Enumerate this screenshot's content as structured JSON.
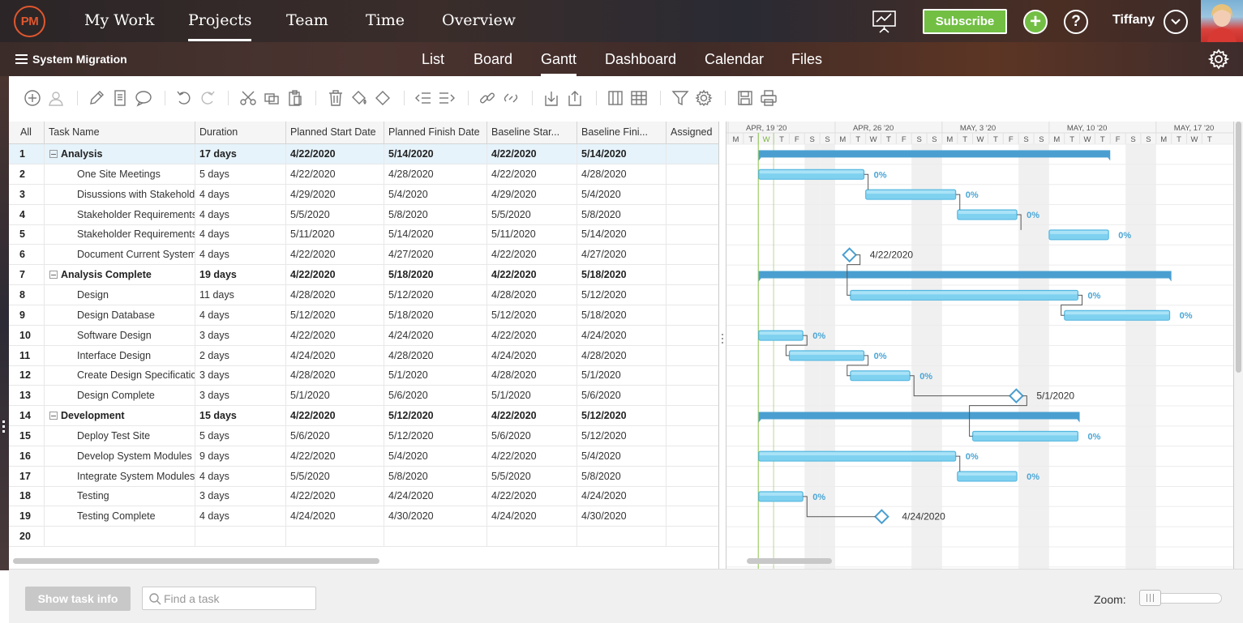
{
  "topnav": {
    "logo": "PM",
    "items": [
      "My Work",
      "Projects",
      "Team",
      "Time",
      "Overview"
    ],
    "active": "Projects",
    "subscribe": "Subscribe",
    "user": "Tiffany"
  },
  "subnav": {
    "project": "System Migration",
    "items": [
      "List",
      "Board",
      "Gantt",
      "Dashboard",
      "Calendar",
      "Files"
    ],
    "active": "Gantt"
  },
  "grid": {
    "columns": [
      "All",
      "Task Name",
      "Duration",
      "Planned Start Date",
      "Planned Finish Date",
      "Baseline Star...",
      "Baseline Fini...",
      "Assigned"
    ],
    "rows": [
      {
        "id": "1",
        "name": "Analysis",
        "duration": "17 days",
        "start": "4/22/2020",
        "finish": "5/14/2020",
        "bstart": "4/22/2020",
        "bfinish": "5/14/2020",
        "group": true,
        "selected": true
      },
      {
        "id": "2",
        "name": "One Site Meetings",
        "duration": "5 days",
        "start": "4/22/2020",
        "finish": "4/28/2020",
        "bstart": "4/22/2020",
        "bfinish": "4/28/2020"
      },
      {
        "id": "3",
        "name": "Disussions with Stakehold",
        "duration": "4 days",
        "start": "4/29/2020",
        "finish": "5/4/2020",
        "bstart": "4/29/2020",
        "bfinish": "5/4/2020"
      },
      {
        "id": "4",
        "name": "Stakeholder Requirements",
        "duration": "4 days",
        "start": "5/5/2020",
        "finish": "5/8/2020",
        "bstart": "5/5/2020",
        "bfinish": "5/8/2020"
      },
      {
        "id": "5",
        "name": "Stakeholder Requirements",
        "duration": "4 days",
        "start": "5/11/2020",
        "finish": "5/14/2020",
        "bstart": "5/11/2020",
        "bfinish": "5/14/2020"
      },
      {
        "id": "6",
        "name": "Document Current System",
        "duration": "4 days",
        "start": "4/22/2020",
        "finish": "4/27/2020",
        "bstart": "4/22/2020",
        "bfinish": "4/27/2020"
      },
      {
        "id": "7",
        "name": "Analysis Complete",
        "duration": "19 days",
        "start": "4/22/2020",
        "finish": "5/18/2020",
        "bstart": "4/22/2020",
        "bfinish": "5/18/2020",
        "group": true
      },
      {
        "id": "8",
        "name": "Design",
        "duration": "11 days",
        "start": "4/28/2020",
        "finish": "5/12/2020",
        "bstart": "4/28/2020",
        "bfinish": "5/12/2020"
      },
      {
        "id": "9",
        "name": "Design Database",
        "duration": "4 days",
        "start": "5/12/2020",
        "finish": "5/18/2020",
        "bstart": "5/12/2020",
        "bfinish": "5/18/2020"
      },
      {
        "id": "10",
        "name": "Software Design",
        "duration": "3 days",
        "start": "4/22/2020",
        "finish": "4/24/2020",
        "bstart": "4/22/2020",
        "bfinish": "4/24/2020"
      },
      {
        "id": "11",
        "name": "Interface Design",
        "duration": "2 days",
        "start": "4/24/2020",
        "finish": "4/28/2020",
        "bstart": "4/24/2020",
        "bfinish": "4/28/2020"
      },
      {
        "id": "12",
        "name": "Create Design Specificatic",
        "duration": "3 days",
        "start": "4/28/2020",
        "finish": "5/1/2020",
        "bstart": "4/28/2020",
        "bfinish": "5/1/2020"
      },
      {
        "id": "13",
        "name": "Design Complete",
        "duration": "3 days",
        "start": "5/1/2020",
        "finish": "5/6/2020",
        "bstart": "5/1/2020",
        "bfinish": "5/6/2020"
      },
      {
        "id": "14",
        "name": "Development",
        "duration": "15 days",
        "start": "4/22/2020",
        "finish": "5/12/2020",
        "bstart": "4/22/2020",
        "bfinish": "5/12/2020",
        "group": true
      },
      {
        "id": "15",
        "name": "Deploy Test Site",
        "duration": "5 days",
        "start": "5/6/2020",
        "finish": "5/12/2020",
        "bstart": "5/6/2020",
        "bfinish": "5/12/2020"
      },
      {
        "id": "16",
        "name": "Develop System Modules",
        "duration": "9 days",
        "start": "4/22/2020",
        "finish": "5/4/2020",
        "bstart": "4/22/2020",
        "bfinish": "5/4/2020"
      },
      {
        "id": "17",
        "name": "Integrate System Modules",
        "duration": "4 days",
        "start": "5/5/2020",
        "finish": "5/8/2020",
        "bstart": "5/5/2020",
        "bfinish": "5/8/2020"
      },
      {
        "id": "18",
        "name": "Testing",
        "duration": "3 days",
        "start": "4/22/2020",
        "finish": "4/24/2020",
        "bstart": "4/22/2020",
        "bfinish": "4/24/2020"
      },
      {
        "id": "19",
        "name": "Testing Complete",
        "duration": "4 days",
        "start": "4/24/2020",
        "finish": "4/30/2020",
        "bstart": "4/24/2020",
        "bfinish": "4/30/2020"
      },
      {
        "id": "20",
        "name": "",
        "duration": "",
        "start": "",
        "finish": "",
        "bstart": "",
        "bfinish": ""
      }
    ]
  },
  "gantt": {
    "week_labels": [
      "APR, 19 '20",
      "APR, 26 '20",
      "MAY, 3 '20",
      "MAY, 10 '20",
      "MAY, 17 '20"
    ],
    "day_letters": [
      "M",
      "T",
      "W",
      "T",
      "F",
      "S",
      "S",
      "M",
      "T",
      "W",
      "T",
      "F",
      "S",
      "S",
      "M",
      "T",
      "W",
      "T",
      "F",
      "S",
      "S",
      "M",
      "T",
      "W",
      "T",
      "F",
      "S",
      "S",
      "M",
      "T",
      "W",
      "T"
    ],
    "progress_label": "0%",
    "milestone_labels": [
      "4/22/2020",
      "5/1/2020",
      "4/24/2020"
    ],
    "colors": {
      "summary": "#4a9fd0",
      "task": "#7fd1f0",
      "task_border": "#4fb3dd",
      "milestone": "#4a9fd0",
      "today": "#8bc34a"
    }
  },
  "footer": {
    "show_task_info": "Show task info",
    "find_placeholder": "Find a task",
    "zoom_label": "Zoom:"
  }
}
